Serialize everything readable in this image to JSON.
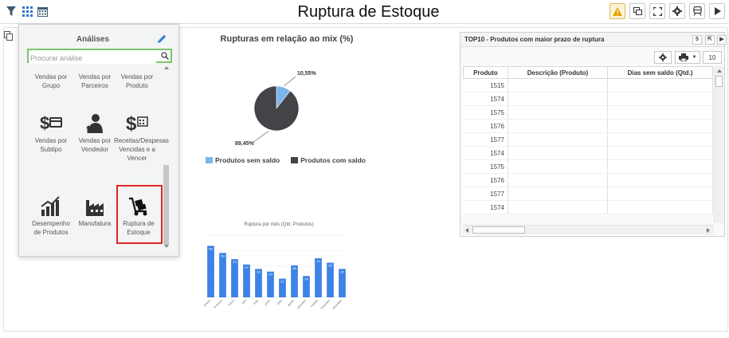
{
  "header": {
    "title": "Ruptura de Estoque"
  },
  "analyses": {
    "title": "Análises",
    "search_placeholder": "Procurar análise",
    "items": [
      {
        "label": "Vendas por Grupo",
        "icon": "group-sales-icon"
      },
      {
        "label": "Vendas por Parceiros",
        "icon": "partner-sales-icon"
      },
      {
        "label": "Vendas por Produto",
        "icon": "product-sales-icon"
      },
      {
        "label": "Vendas por Subtipo",
        "icon": "subtype-sales-icon"
      },
      {
        "label": "Vendas por Vendedor",
        "icon": "seller-icon"
      },
      {
        "label": "Receitas/Despesas Vencidas e a Vencer",
        "icon": "revenue-expense-icon"
      },
      {
        "label": "Desempenho de Produtos",
        "icon": "performance-icon"
      },
      {
        "label": "Manufatura",
        "icon": "factory-icon"
      },
      {
        "label": "Ruptura de Estoque",
        "icon": "hand-truck-icon",
        "selected": true
      }
    ]
  },
  "pie": {
    "title": "Rupturas em relação ao mix (%)",
    "slices": [
      {
        "name": "Produtos sem saldo",
        "value": 10.55,
        "label": "10,55%",
        "color": "#7cb5ec"
      },
      {
        "name": "Produtos com saldo",
        "value": 89.45,
        "label": "89,45%",
        "color": "#434348"
      }
    ]
  },
  "chart_data": {
    "type": "bar",
    "title": "Ruptura por mês (Qtd. Produtos)",
    "categories": [
      "janeiro",
      "fevereiro",
      "março",
      "abril",
      "maio",
      "junho",
      "julho",
      "agosto",
      "setembro",
      "outubro",
      "novembro",
      "dezembro"
    ],
    "values": [
      58,
      50,
      43,
      37,
      32,
      29,
      21,
      36,
      24,
      44,
      39,
      32
    ],
    "color": "#3d82e6",
    "ylim": [
      0,
      70
    ]
  },
  "table": {
    "title": "TOP10 - Produtos com maior prazo de ruptura",
    "page_size": "10",
    "columns": [
      "Produto",
      "Descrição (Produto)",
      "Dias sem saldo (Qtd.)"
    ],
    "rows": [
      [
        "1515",
        "",
        ""
      ],
      [
        "1574",
        "",
        ""
      ],
      [
        "1575",
        "",
        ""
      ],
      [
        "1576",
        "",
        ""
      ],
      [
        "1577",
        "",
        ""
      ],
      [
        "1574",
        "",
        ""
      ],
      [
        "1575",
        "",
        ""
      ],
      [
        "1576",
        "",
        ""
      ],
      [
        "1577",
        "",
        ""
      ],
      [
        "1574",
        "",
        ""
      ]
    ]
  }
}
